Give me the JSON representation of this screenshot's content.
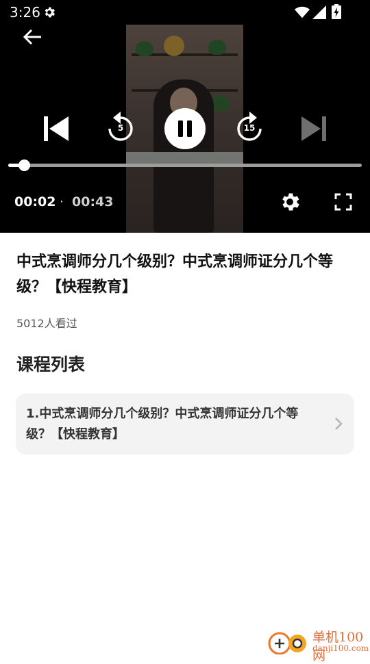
{
  "status_bar": {
    "time": "3:26"
  },
  "player": {
    "current_time": "00:02",
    "separator": "·",
    "total_time": "00:43",
    "rewind_seconds": "5",
    "forward_seconds": "15",
    "progress_fraction": 0.045
  },
  "video": {
    "title": "中式烹调师分几个级别？中式烹调师证分几个等级？【快程教育】",
    "view_count": "5012人看过"
  },
  "course_list": {
    "heading": "课程列表",
    "items": [
      {
        "label": "1.中式烹调师分几个级别？中式烹调师证分几个等级？【快程教育】"
      }
    ]
  },
  "watermark": {
    "text_cn": "单机100网",
    "text_en": "danji100.com"
  }
}
